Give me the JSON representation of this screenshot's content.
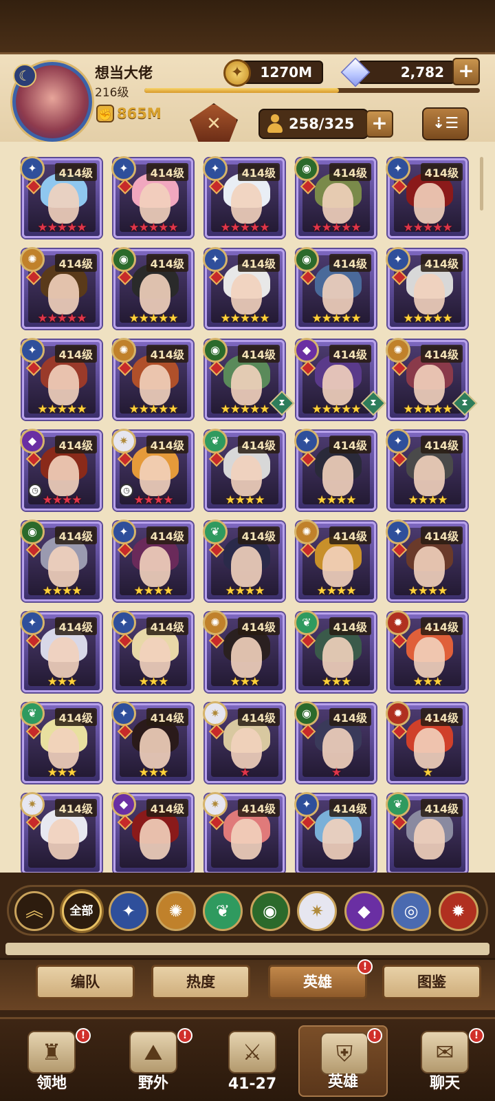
{
  "player": {
    "name": "想当大佬",
    "level": "216级",
    "xp_progress": 0.58,
    "power": "865M"
  },
  "resources": {
    "gold": "1270M",
    "diamonds": "2,782"
  },
  "hero_count": "258/325",
  "heroes": [
    {
      "level": "414级",
      "faction": "lightbearer",
      "stars": "★★★★★",
      "star_color": "red"
    },
    {
      "level": "414级",
      "faction": "lightbearer",
      "stars": "★★★★★",
      "star_color": "red"
    },
    {
      "level": "414级",
      "faction": "lightbearer",
      "stars": "★★★★★",
      "star_color": "red"
    },
    {
      "level": "414级",
      "faction": "graveborn",
      "stars": "★★★★★",
      "star_color": "red"
    },
    {
      "level": "414级",
      "faction": "lightbearer",
      "stars": "★★★★★",
      "star_color": "red"
    },
    {
      "level": "414级",
      "faction": "mauler",
      "stars": "★★★★★",
      "star_color": "red"
    },
    {
      "level": "414级",
      "faction": "graveborn",
      "stars": "★★★★★",
      "star_color": "gold"
    },
    {
      "level": "414级",
      "faction": "lightbearer",
      "stars": "★★★★★",
      "star_color": "gold"
    },
    {
      "level": "414级",
      "faction": "graveborn",
      "stars": "★★★★★",
      "star_color": "gold"
    },
    {
      "level": "414级",
      "faction": "lightbearer",
      "stars": "★★★★★",
      "star_color": "gold"
    },
    {
      "level": "414级",
      "faction": "lightbearer",
      "stars": "★★★★★",
      "star_color": "gold"
    },
    {
      "level": "414级",
      "faction": "mauler",
      "stars": "★★★★★",
      "star_color": "gold"
    },
    {
      "level": "414级",
      "faction": "graveborn",
      "stars": "★★★★★",
      "star_color": "gold",
      "hourglass": true
    },
    {
      "level": "414级",
      "faction": "hypogean",
      "stars": "★★★★★",
      "star_color": "gold",
      "hourglass": true
    },
    {
      "level": "414级",
      "faction": "mauler",
      "stars": "★★★★★",
      "star_color": "gold",
      "hourglass": true
    },
    {
      "level": "414级",
      "faction": "hypogean",
      "stars": "★★★★",
      "star_color": "red",
      "clock": true
    },
    {
      "level": "414级",
      "faction": "celestial",
      "stars": "★★★★",
      "star_color": "red",
      "clock": true
    },
    {
      "level": "414级",
      "faction": "wilder",
      "stars": "★★★★",
      "star_color": "gold"
    },
    {
      "level": "414级",
      "faction": "lightbearer",
      "stars": "★★★★",
      "star_color": "gold"
    },
    {
      "level": "414级",
      "faction": "lightbearer",
      "stars": "★★★★",
      "star_color": "gold"
    },
    {
      "level": "414级",
      "faction": "graveborn",
      "stars": "★★★★",
      "star_color": "gold"
    },
    {
      "level": "414级",
      "faction": "lightbearer",
      "stars": "★★★★",
      "star_color": "gold"
    },
    {
      "level": "414级",
      "faction": "wilder",
      "stars": "★★★★",
      "star_color": "gold"
    },
    {
      "level": "414级",
      "faction": "mauler",
      "stars": "★★★★",
      "star_color": "gold"
    },
    {
      "level": "414级",
      "faction": "lightbearer",
      "stars": "★★★★",
      "star_color": "gold"
    },
    {
      "level": "414级",
      "faction": "lightbearer",
      "stars": "★★★",
      "star_color": "gold"
    },
    {
      "level": "414级",
      "faction": "lightbearer",
      "stars": "★★★",
      "star_color": "gold"
    },
    {
      "level": "414级",
      "faction": "mauler",
      "stars": "★★★",
      "star_color": "gold"
    },
    {
      "level": "414级",
      "faction": "wilder",
      "stars": "★★★",
      "star_color": "gold"
    },
    {
      "level": "414级",
      "faction": "dimensional",
      "stars": "★★★",
      "star_color": "gold"
    },
    {
      "level": "414级",
      "faction": "wilder",
      "stars": "★★★",
      "star_color": "gold"
    },
    {
      "level": "414级",
      "faction": "lightbearer",
      "stars": "★★★",
      "star_color": "gold"
    },
    {
      "level": "414级",
      "faction": "celestial",
      "stars": "★",
      "star_color": "red"
    },
    {
      "level": "414级",
      "faction": "graveborn",
      "stars": "★",
      "star_color": "red"
    },
    {
      "level": "414级",
      "faction": "dimensional",
      "stars": "★",
      "star_color": "gold"
    },
    {
      "level": "414级",
      "faction": "celestial",
      "stars": "",
      "star_color": "gold"
    },
    {
      "level": "414级",
      "faction": "hypogean",
      "stars": "",
      "star_color": "gold"
    },
    {
      "level": "414级",
      "faction": "celestial",
      "stars": "",
      "star_color": "gold"
    },
    {
      "level": "414级",
      "faction": "lightbearer",
      "stars": "",
      "star_color": "gold"
    },
    {
      "level": "414级",
      "faction": "wilder",
      "stars": "",
      "star_color": "gold"
    }
  ],
  "filters": [
    {
      "icon": "collapse-up-icon",
      "label": ""
    },
    {
      "icon": "all-factions",
      "label": "全部"
    },
    {
      "icon": "lightbearer-icon",
      "label": ""
    },
    {
      "icon": "mauler-icon",
      "label": ""
    },
    {
      "icon": "wilder-icon",
      "label": ""
    },
    {
      "icon": "graveborn-icon",
      "label": ""
    },
    {
      "icon": "celestial-icon",
      "label": ""
    },
    {
      "icon": "hypogean-icon",
      "label": ""
    },
    {
      "icon": "dimensional-icon",
      "label": ""
    },
    {
      "icon": "dimensional-alt-icon",
      "label": ""
    }
  ],
  "subtabs": [
    {
      "label": "编队",
      "active": false,
      "badge": false
    },
    {
      "label": "热度",
      "active": false,
      "badge": false
    },
    {
      "label": "英雄",
      "active": true,
      "badge": true
    },
    {
      "label": "图鉴",
      "active": false,
      "badge": false
    }
  ],
  "nav": [
    {
      "label": "领地",
      "icon": "castle-icon",
      "badge": true,
      "active": false
    },
    {
      "label": "野外",
      "icon": "map-icon",
      "badge": true,
      "active": false
    },
    {
      "label": "41-27",
      "icon": "crossed-swords-icon",
      "badge": false,
      "active": false
    },
    {
      "label": "英雄",
      "icon": "hero-helmet-icon",
      "badge": true,
      "active": true
    },
    {
      "label": "聊天",
      "icon": "chat-bubble-icon",
      "badge": true,
      "active": false
    }
  ],
  "colors": {
    "lightbearer": "#2f4f9b",
    "mauler": "#c0812b",
    "wilder": "#2f9a5f",
    "graveborn": "#2b6a2b",
    "celestial": "#e6e6f0",
    "hypogean": "#6a2fa3",
    "dimensional": "#b03020",
    "accent": "#e8c063"
  }
}
